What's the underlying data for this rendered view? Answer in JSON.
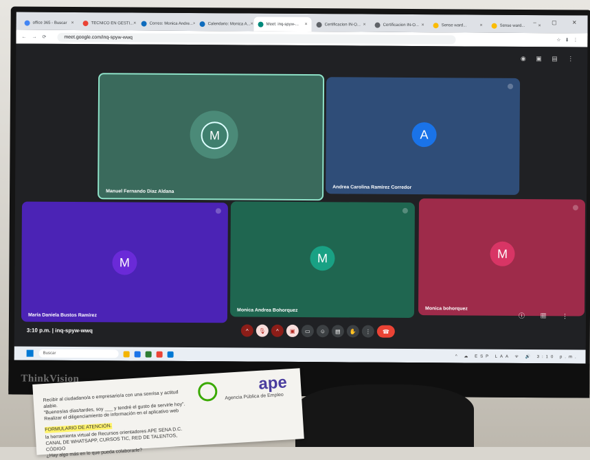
{
  "browser": {
    "tabs": [
      {
        "label": "office 365 - Buscar",
        "color": "#4285f4",
        "active": false
      },
      {
        "label": "TECNICO EN GESTI...",
        "color": "#ea4335",
        "active": false
      },
      {
        "label": "Correo: Monica Andre...",
        "color": "#0f6cbd",
        "active": false
      },
      {
        "label": "Calendario: Monica A...",
        "color": "#0f6cbd",
        "active": false
      },
      {
        "label": "Meet: inq-spyw-...",
        "color": "#00897b",
        "active": true
      },
      {
        "label": "Certificacion IN-O...",
        "color": "#5f6368",
        "active": false
      },
      {
        "label": "Certificacion IN-O...",
        "color": "#5f6368",
        "active": false
      },
      {
        "label": "Sense ward...",
        "color": "#fbbc04",
        "active": false
      },
      {
        "label": "Sense ward...",
        "color": "#fbbc04",
        "active": false
      }
    ],
    "url": "meet.google.com/inq-spyw-wwq",
    "window_controls": "– ▢ ✕"
  },
  "meet": {
    "top_icons": "◉ ▣ ▤ ⋮",
    "tiles": [
      {
        "name": "Manuel Fernando Diaz Aldana",
        "initial": "M",
        "speaking": true
      },
      {
        "name": "Andrea Carolina Ramírez Corredor",
        "initial": "A"
      },
      {
        "name": "María Daniela Bustos Ramírez",
        "initial": "M"
      },
      {
        "name": "Monica Andrea Bohorquez",
        "initial": "M"
      },
      {
        "name": "Monica bohorquez",
        "initial": "M"
      }
    ],
    "time": "3:10 p.m.",
    "separator": "|",
    "code": "inq-spyw-wwq",
    "controls": {
      "mic_caret": "^",
      "mic": "🎙",
      "cam_caret": "^",
      "cam": "▣",
      "captions": "▭",
      "emoji": "☺",
      "present": "▤",
      "hand": "✋",
      "more": "⋮",
      "leave": "☎"
    },
    "right_controls": "ⓘ ▦ ⋮"
  },
  "taskbar": {
    "search_placeholder": "Buscar",
    "apps": [
      "#f4b400",
      "#1a73e8",
      "#2e7d32",
      "#ea4335",
      "#0078d4"
    ],
    "tray": "^ ☁ ESP LAA ᯤ 🔊 3:10 p.m."
  },
  "monitor": {
    "brand": "ThinkVision"
  },
  "paper": {
    "logo": "ape",
    "logo_sub": "Agencia Pública de Empleo",
    "lines": [
      "Recibir al ciudadano/a o empresario/a con una sonrisa y actitud alabie.",
      "\"Buenos/as días/tardes, soy ___ y tendré el gusto de servirle hoy\".",
      "Realizar el diligenciamiento de información en el aplicativo web",
      "FORMULARIO DE ATENCIÓN.",
      "la herramienta virtual de Recursos orientadores APE SENA D.C.",
      "CANAL DE WHATSAPP, CURSOS TIC, RED DE TALENTOS, CÓDIGO",
      "¿Hay algo más en lo que pueda colaborarle?"
    ]
  }
}
